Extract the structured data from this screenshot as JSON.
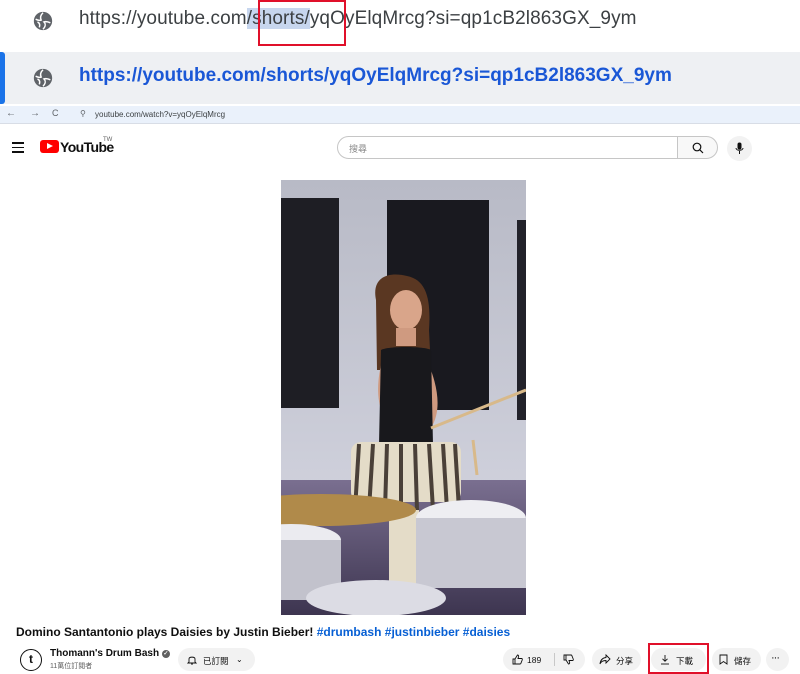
{
  "address_bar": {
    "url_prefix": "https://youtube.com",
    "url_highlight": "/shorts/",
    "url_suffix": "yqOyElqMrcg?si=qp1cB2l863GX_9ym",
    "suggestion_url": "https://youtube.com/shorts/yqOyElqMrcg?si=qp1cB2l863GX_9ym"
  },
  "mini_browser": {
    "back": "←",
    "forward": "→",
    "reload": "C",
    "address": "youtube.com/watch?v=yqOyElqMrcg"
  },
  "youtube": {
    "logo_text": "YouTube",
    "region": "TW",
    "search_placeholder": "搜尋"
  },
  "video": {
    "title": "Domino Santantonio plays Daisies by Justin Bieber!",
    "hashtags": "#drumbash #justinbieber #daisies",
    "channel_initial": "t",
    "channel_name": "Thomann's Drum Bash",
    "subscribers": "11萬位訂閱者",
    "subscribed_label": "已訂閱",
    "likes": "189",
    "share_label": "分享",
    "download_label": "下載",
    "save_label": "儲存"
  },
  "colors": {
    "highlight_box": "#e0102a",
    "link_blue": "#065fd4",
    "suggestion_blue": "#1a57d6",
    "yt_red": "#ff0000"
  }
}
